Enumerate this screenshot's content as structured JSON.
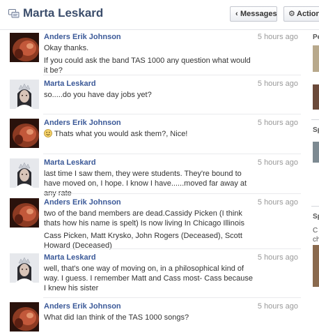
{
  "header": {
    "title": "Marta Leskard",
    "messages_button": "Messages",
    "actions_button": "Actions"
  },
  "messages": [
    {
      "author": "Anders Erik Johnson",
      "time": "5 hours ago",
      "lines": [
        "Okay thanks.",
        "If you could ask the band TAS 1000 any question what would it be?"
      ]
    },
    {
      "author": "Marta Leskard",
      "time": "5 hours ago",
      "lines": [
        "so.....do you have day jobs yet?"
      ]
    },
    {
      "author": "Anders Erik Johnson",
      "time": "5 hours ago",
      "lines": [
        "Thats what you would ask them?, Nice!"
      ]
    },
    {
      "author": "Marta Leskard",
      "time": "5 hours ago",
      "lines": [
        "last time I saw them, they were students. They're bound to have moved on, I hope. I know I have......moved far away at any rate"
      ]
    },
    {
      "author": "Anders Erik Johnson",
      "time": "5 hours ago",
      "lines": [
        "two of the band members are dead.Cassidy Picken (I think thats how his name is spelt) Is now living In Chicago Illinois",
        "Cass Picken, Matt Krysko, John Rogers (Deceased), Scott Howard (Deceased)"
      ]
    },
    {
      "author": "Marta Leskard",
      "time": "5 hours ago",
      "lines": [
        "well, that's one way of moving on, in a philosophical kind of way. I guess. I remember Matt and Cass most- Cass because I knew his sister"
      ]
    },
    {
      "author": "Anders Erik Johnson",
      "time": "5 hours ago",
      "lines": [
        "What did Ian think of the TAS 1000 songs?"
      ]
    }
  ],
  "right_column": {
    "fragments": [
      "Pe",
      "Sp",
      "Sp",
      "C",
      "ch"
    ]
  },
  "colors": {
    "link_blue": "#3b5998",
    "title_navy": "#3b4d6b",
    "time_gray": "#999999",
    "divider": "#e9eaed"
  }
}
